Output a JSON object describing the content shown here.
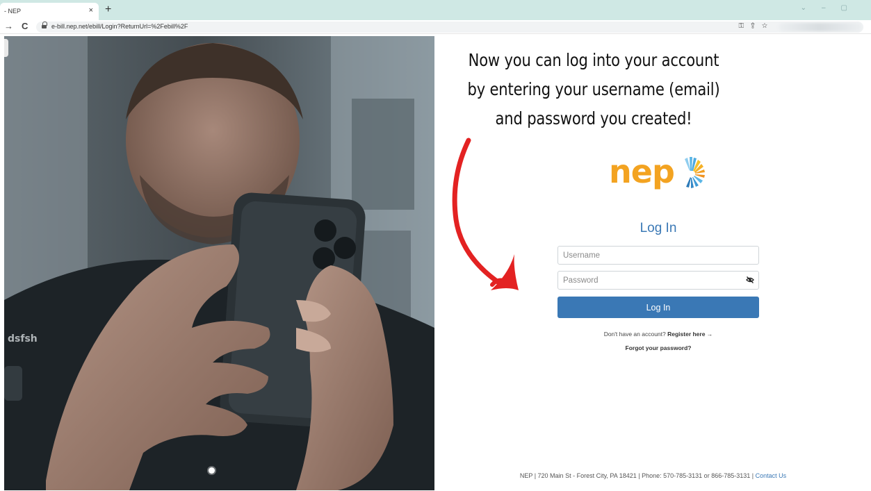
{
  "browser": {
    "tab_title": "- NEP",
    "tab_close": "×",
    "new_tab": "+",
    "back_icon": "→",
    "reload_icon": "C",
    "url": "e-bill.nep.net/ebill/Login?ReturnUrl=%2Febill%2F",
    "toolbar_icons": [
      "key-icon",
      "share-icon",
      "star-icon"
    ],
    "window_controls": [
      "chevron-down-icon",
      "minimize-icon",
      "restore-icon"
    ]
  },
  "annotation": {
    "headline": "Now you can log into your account by entering your username (email) and password you created!",
    "arrow_color": "#e32222"
  },
  "brand": {
    "logo_text": "nep",
    "logo_color": "#f3a321"
  },
  "login": {
    "title": "Log In",
    "username_placeholder": "Username",
    "password_placeholder": "Password",
    "button_label": "Log In",
    "register_prompt": "Don't have an account?",
    "register_link": "Register here →",
    "forgot_link": "Forgot your password?",
    "accent_color": "#3a78b5"
  },
  "footer": {
    "text": "NEP | 720 Main St - Forest City, PA 18421 | Phone: 570-785-3131 or 866-785-3131 |",
    "contact_link": "Contact Us"
  }
}
